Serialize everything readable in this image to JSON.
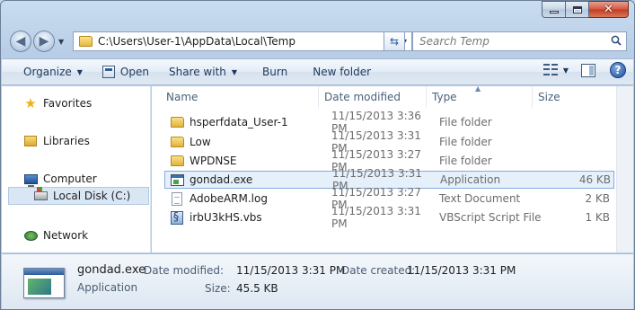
{
  "window": {
    "caption": {
      "minimize": "",
      "maximize": "",
      "close": "✕"
    }
  },
  "address": {
    "path": "C:\\Users\\User-1\\AppData\\Local\\Temp",
    "search_placeholder": "Search Temp"
  },
  "toolbar": {
    "organize": "Organize",
    "open": "Open",
    "share_with": "Share with",
    "burn": "Burn",
    "new_folder": "New folder"
  },
  "nav": {
    "favorites": "Favorites",
    "libraries": "Libraries",
    "computer": "Computer",
    "local_disk": "Local Disk (C:)",
    "network": "Network"
  },
  "columns": {
    "name": "Name",
    "date_modified": "Date modified",
    "type": "Type",
    "size": "Size"
  },
  "files": [
    {
      "icon": "folder-icon",
      "name": "hsperfdata_User-1",
      "date": "11/15/2013 3:36 PM",
      "type": "File folder",
      "size": ""
    },
    {
      "icon": "folder-icon",
      "name": "Low",
      "date": "11/15/2013 3:31 PM",
      "type": "File folder",
      "size": ""
    },
    {
      "icon": "folder-icon",
      "name": "WPDNSE",
      "date": "11/15/2013 3:27 PM",
      "type": "File folder",
      "size": ""
    },
    {
      "icon": "application-icon",
      "name": "gondad.exe",
      "date": "11/15/2013 3:31 PM",
      "type": "Application",
      "size": "46 KB"
    },
    {
      "icon": "text-document-icon",
      "name": "AdobeARM.log",
      "date": "11/15/2013 3:27 PM",
      "type": "Text Document",
      "size": "2 KB"
    },
    {
      "icon": "vbscript-icon",
      "name": "irbU3kHS.vbs",
      "date": "11/15/2013 3:31 PM",
      "type": "VBScript Script File",
      "size": "1 KB"
    }
  ],
  "details": {
    "name": "gondad.exe",
    "type": "Application",
    "date_modified_label": "Date modified:",
    "date_modified": "11/15/2013 3:31 PM",
    "date_created_label": "Date created:",
    "date_created": "11/15/2013 3:31 PM",
    "size_label": "Size:",
    "size": "45.5 KB"
  },
  "colors": {
    "selection": "#e5f0fb",
    "selection_border": "#84acdd",
    "toolbar_text": "#1e395b"
  }
}
